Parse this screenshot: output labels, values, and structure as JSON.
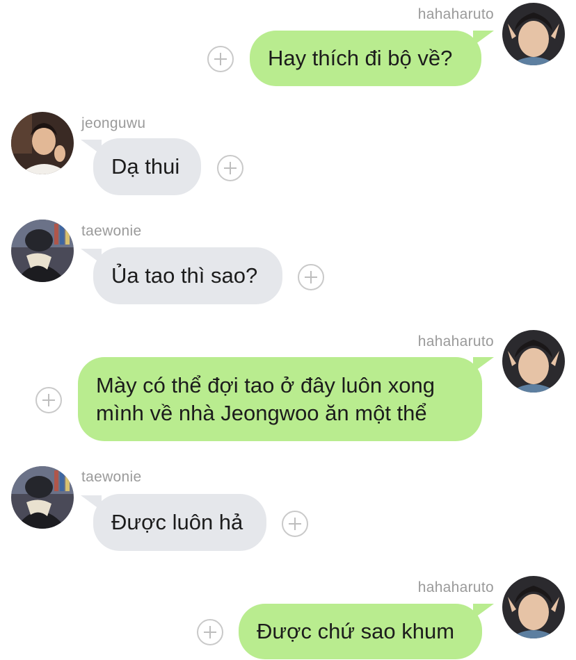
{
  "messages": [
    {
      "sender": "hahaharuto",
      "side": "out",
      "lines": [
        "Hay thích đi bộ về?"
      ]
    },
    {
      "sender": "jeonguwu",
      "side": "in",
      "lines": [
        "Dạ thui"
      ]
    },
    {
      "sender": "taewonie",
      "side": "in",
      "lines": [
        "Ủa tao thì sao?"
      ]
    },
    {
      "sender": "hahaharuto",
      "side": "out",
      "lines": [
        "Mày có thể đợi tao ở đây luôn xong",
        "mình về nhà Jeongwoo ăn một thể"
      ]
    },
    {
      "sender": "taewonie",
      "side": "in",
      "lines": [
        "Được luôn hả"
      ]
    },
    {
      "sender": "hahaharuto",
      "side": "out",
      "lines": [
        "Được chứ sao khum"
      ]
    }
  ],
  "colors": {
    "outgoing_bubble": "#b9ec8f",
    "incoming_bubble": "#e5e7eb",
    "sender_name": "#9a9a9a"
  },
  "icons": {
    "add_reaction": "plus-circle-icon"
  }
}
